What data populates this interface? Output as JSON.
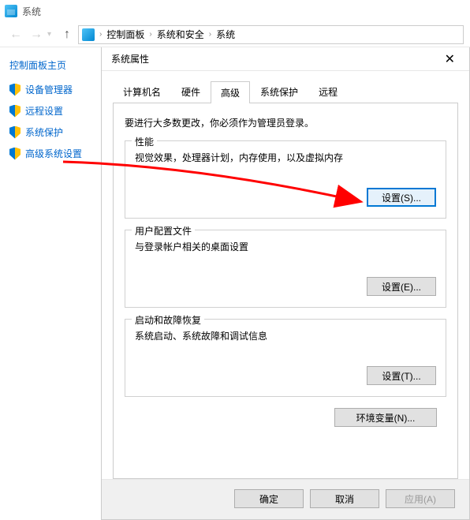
{
  "titlebar": {
    "text": "系统"
  },
  "breadcrumb": {
    "items": [
      "控制面板",
      "系统和安全",
      "系统"
    ]
  },
  "sidebar": {
    "title": "控制面板主页",
    "items": [
      {
        "label": "设备管理器"
      },
      {
        "label": "远程设置"
      },
      {
        "label": "系统保护"
      },
      {
        "label": "高级系统设置"
      }
    ]
  },
  "dialog": {
    "title": "系统属性",
    "tabs": [
      "计算机名",
      "硬件",
      "高级",
      "系统保护",
      "远程"
    ],
    "active_tab": "高级",
    "intro": "要进行大多数更改，你必须作为管理员登录。",
    "sections": {
      "performance": {
        "legend": "性能",
        "text": "视觉效果，处理器计划，内存使用，以及虚拟内存",
        "button": "设置(S)..."
      },
      "user_profiles": {
        "legend": "用户配置文件",
        "text": "与登录帐户相关的桌面设置",
        "button": "设置(E)..."
      },
      "startup": {
        "legend": "启动和故障恢复",
        "text": "系统启动、系统故障和调试信息",
        "button": "设置(T)..."
      }
    },
    "env_button": "环境变量(N)...",
    "footer": {
      "ok": "确定",
      "cancel": "取消",
      "apply": "应用(A)"
    }
  }
}
